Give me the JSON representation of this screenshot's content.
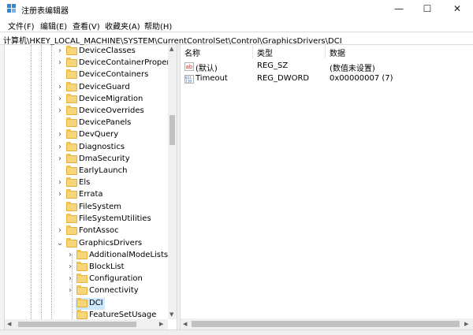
{
  "window": {
    "title": "注册表编辑器",
    "minimize": "—",
    "maximize": "☐",
    "close": "✕"
  },
  "menu": [
    "文件(F)",
    "编辑(E)",
    "查看(V)",
    "收藏夹(A)",
    "帮助(H)"
  ],
  "address": "计算机\\HKEY_LOCAL_MACHINE\\SYSTEM\\CurrentControlSet\\Control\\GraphicsDrivers\\DCI",
  "tree": {
    "items": [
      {
        "label": "DeviceClasses",
        "level": 0
      },
      {
        "label": "DeviceContainerPropertyU",
        "level": 0
      },
      {
        "label": "DeviceContainers",
        "level": 0
      },
      {
        "label": "DeviceGuard",
        "level": 0
      },
      {
        "label": "DeviceMigration",
        "level": 0
      },
      {
        "label": "DeviceOverrides",
        "level": 0
      },
      {
        "label": "DevicePanels",
        "level": 0
      },
      {
        "label": "DevQuery",
        "level": 0
      },
      {
        "label": "Diagnostics",
        "level": 0
      },
      {
        "label": "DmaSecurity",
        "level": 0
      },
      {
        "label": "EarlyLaunch",
        "level": 0
      },
      {
        "label": "Els",
        "level": 0
      },
      {
        "label": "Errata",
        "level": 0
      },
      {
        "label": "FileSystem",
        "level": 0
      },
      {
        "label": "FileSystemUtilities",
        "level": 0
      },
      {
        "label": "FontAssoc",
        "level": 0
      },
      {
        "label": "GraphicsDrivers",
        "level": 0,
        "expanded": true
      },
      {
        "label": "AdditionalModeLists",
        "level": 1
      },
      {
        "label": "BlockList",
        "level": 1
      },
      {
        "label": "Configuration",
        "level": 1
      },
      {
        "label": "Connectivity",
        "level": 1
      },
      {
        "label": "DCI",
        "level": 1,
        "selected": true
      },
      {
        "label": "FeatureSetUsage",
        "level": 1
      }
    ]
  },
  "list": {
    "headers": {
      "name": "名称",
      "type": "类型",
      "data": "数据"
    },
    "rows": [
      {
        "icon": "string-value-icon",
        "name": "(默认)",
        "type": "REG_SZ",
        "data": "(数值未设置)"
      },
      {
        "icon": "binary-value-icon",
        "name": "Timeout",
        "type": "REG_DWORD",
        "data": "0x00000007 (7)"
      }
    ]
  },
  "colors": {
    "selection": "#cde8ff",
    "folder": "#f7d67a",
    "accent": "#0078d7"
  }
}
